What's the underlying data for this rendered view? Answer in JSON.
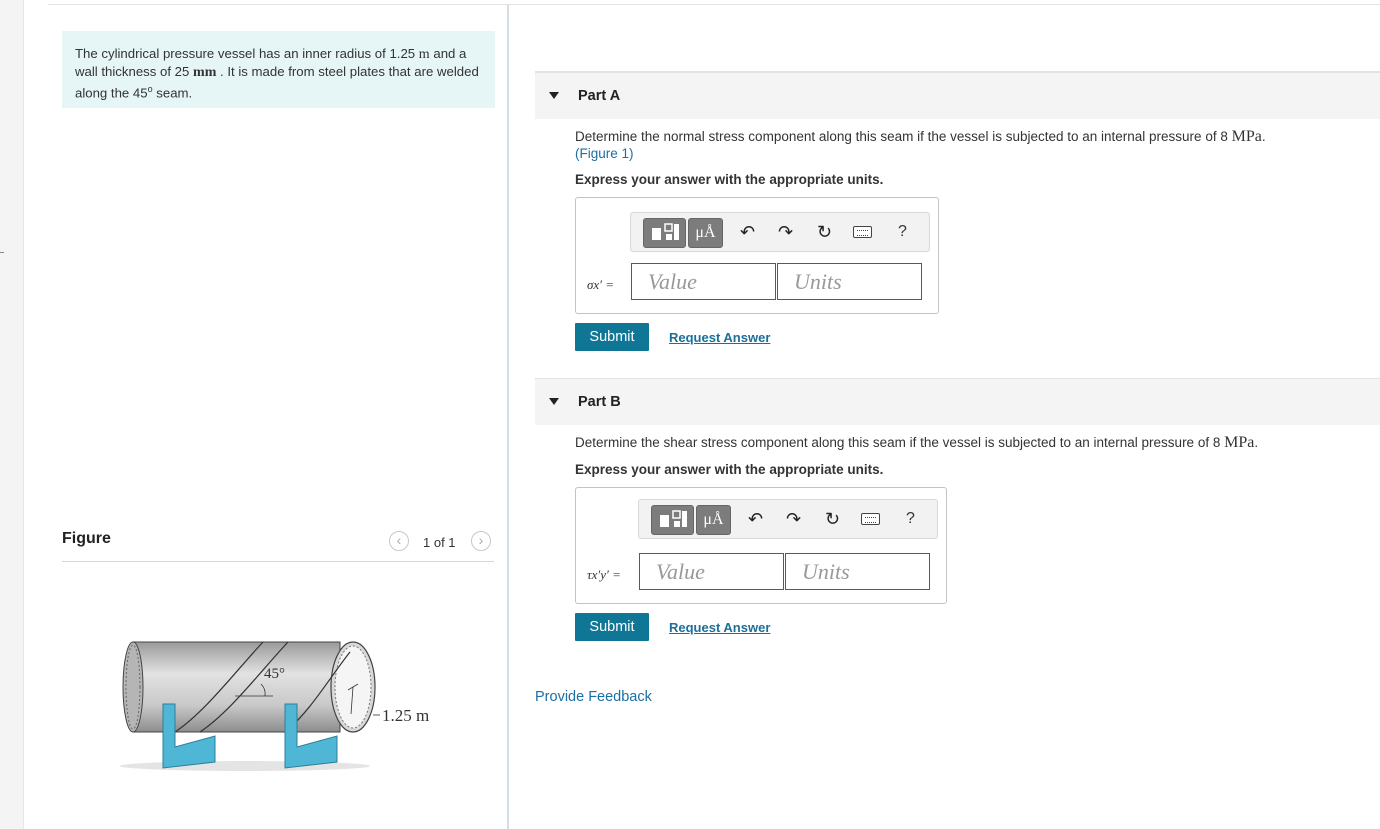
{
  "problem": {
    "text_a": "The cylindrical pressure vessel has an inner radius of 1.25",
    "unit_m": "m",
    "text_b": "and a wall thickness of 25",
    "unit_mm": "mm",
    "text_c": ". It is made from steel plates that are welded along the 45",
    "deg": "o",
    "text_d": "seam."
  },
  "figure": {
    "title": "Figure",
    "count": "1 of 1",
    "prev_icon": "chevron-left-icon",
    "next_icon": "chevron-right-icon",
    "angle_label": "45°",
    "radius_label": "1.25 m"
  },
  "partA": {
    "label": "Part A",
    "question": "Determine the normal stress component along this seam if the vessel is subjected to an internal pressure of 8",
    "pressure_unit": "MPa",
    "period": ".",
    "figure_link": "(Figure 1)",
    "instruction": "Express your answer with the appropriate units.",
    "variable": "σx′ =",
    "value_placeholder": "Value",
    "units_placeholder": "Units",
    "submit": "Submit",
    "request": "Request Answer"
  },
  "partB": {
    "label": "Part B",
    "question": "Determine the shear stress component along this seam if the vessel is subjected to an internal pressure of 8",
    "pressure_unit": "MPa",
    "period": ".",
    "instruction": "Express your answer with the appropriate units.",
    "variable": "τx′y′ =",
    "value_placeholder": "Value",
    "units_placeholder": "Units",
    "submit": "Submit",
    "request": "Request Answer"
  },
  "toolbar": {
    "units_symbol": "μÅ",
    "undo_icon": "undo-icon",
    "redo_icon": "redo-icon",
    "reset_icon": "reset-icon",
    "keyboard_icon": "keyboard-icon",
    "help": "?"
  },
  "feedback": "Provide Feedback",
  "colors": {
    "accent": "#0f7696",
    "link": "#1a6fa6",
    "problem_bg": "#e6f6f6",
    "support": "#4fb6d6"
  }
}
